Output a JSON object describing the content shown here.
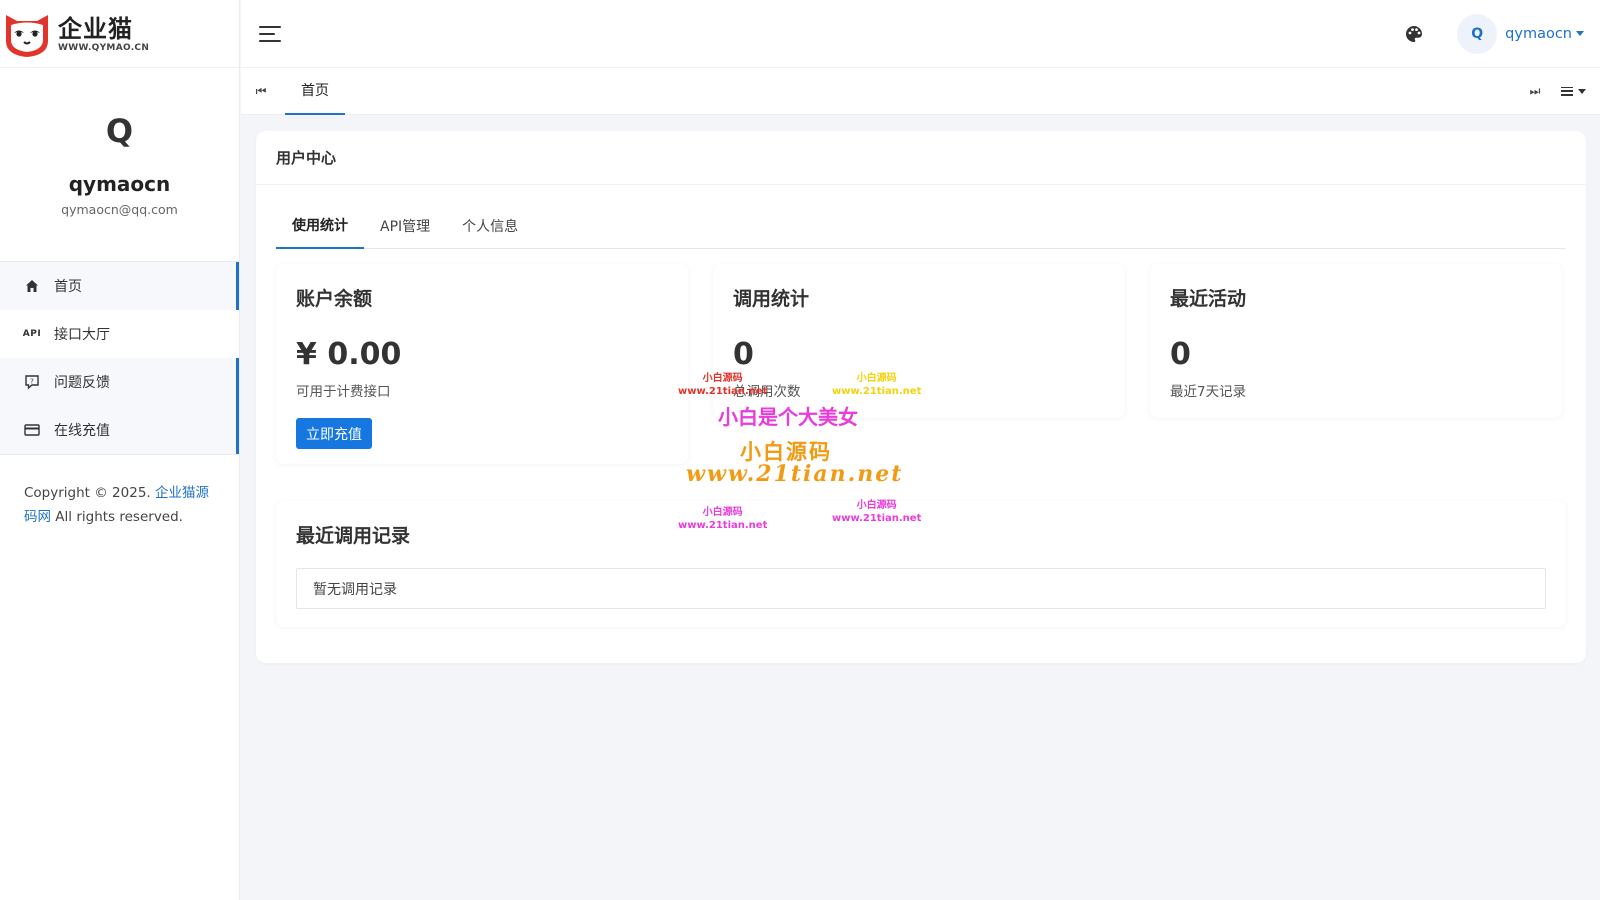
{
  "brand": {
    "name": "企业猫",
    "domain": "WWW.QYMAO.CN",
    "colors": {
      "primary": "#1f72c8",
      "button": "#1677e0",
      "logo": "#e2342b"
    }
  },
  "profile": {
    "initial": "Q",
    "username": "qymaocn",
    "email": "qymaocn@qq.com"
  },
  "sidebar": {
    "items": [
      {
        "label": "首页",
        "icon": "home-icon"
      },
      {
        "label": "接口大厅",
        "icon": "API"
      },
      {
        "label": "问题反馈",
        "icon": "feedback-icon"
      },
      {
        "label": "在线充值",
        "icon": "credit-card-icon"
      }
    ],
    "copyright_prefix": "Copyright © 2025.",
    "copyright_link": "企业猫源码网",
    "copyright_suffix": "All rights reserved."
  },
  "header": {
    "avatar_initial": "Q",
    "username": "qymaocn"
  },
  "tabbar": {
    "home_tab": "首页"
  },
  "main": {
    "card_title": "用户中心",
    "tabs": [
      "使用统计",
      "API管理",
      "个人信息"
    ],
    "stats": [
      {
        "title": "账户余额",
        "value": "¥ 0.00",
        "desc": "可用于计费接口"
      },
      {
        "title": "调用统计",
        "value": "0",
        "desc": "总调用次数"
      },
      {
        "title": "最近活动",
        "value": "0",
        "desc": "最近7天记录"
      }
    ],
    "recharge_button": "立即充值",
    "recent_title": "最近调用记录",
    "recent_empty": "暂无调用记录"
  },
  "watermark": {
    "small_cn": "小白源码",
    "small_url": "www.21tian.net",
    "headline": "小白是个大美女",
    "brush_cn": "小白源码",
    "url": "www.21tian.net"
  }
}
